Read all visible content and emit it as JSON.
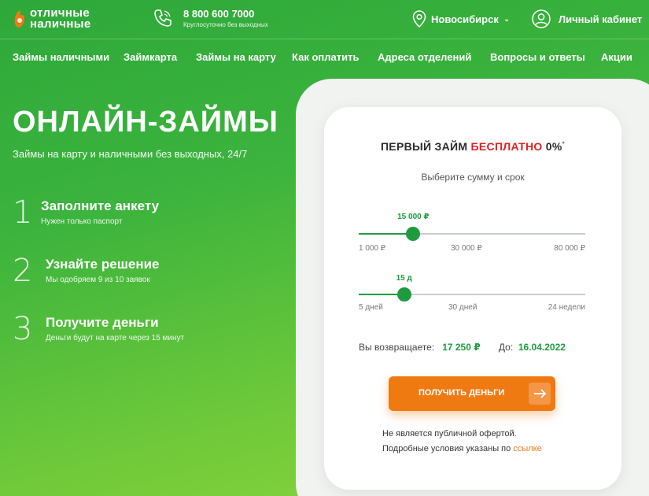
{
  "header": {
    "logo_line1": "отличные",
    "logo_line2": "наличные",
    "phone": "8 800 600 7000",
    "phone_sub": "Круглосуточно без выходных",
    "city": "Новосибирск",
    "cabinet": "Личный кабинет"
  },
  "nav": [
    {
      "label": "Займы наличными"
    },
    {
      "label": "Займкарта"
    },
    {
      "label": "Займы на карту"
    },
    {
      "label": "Как оплатить"
    },
    {
      "label": "Адреса отделений"
    },
    {
      "label": "Вопросы и ответы"
    },
    {
      "label": "Акции"
    }
  ],
  "hero": {
    "title": "ОНЛАЙН-ЗАЙМЫ",
    "subtitle": "Займы на карту и наличными без выходных, 24/7",
    "steps": [
      {
        "num": "1",
        "title": "Заполните анкету",
        "desc": "Нужен только паспорт"
      },
      {
        "num": "2",
        "title": "Узнайте решение",
        "desc": "Мы одобряем 9 из 10 заявок"
      },
      {
        "num": "3",
        "title": "Получите деньги",
        "desc": "Деньги будут на карте через 15 минут"
      }
    ]
  },
  "calculator": {
    "title_pre": "ПЕРВЫЙ ЗАЙМ ",
    "title_free": "БЕСПЛАТНО",
    "title_post": " 0%",
    "title_mark": "*",
    "subtitle": "Выберите сумму и срок",
    "amount": {
      "value_label": "15 000 ₽",
      "fraction": 0.24,
      "ticks": [
        "1 000 ₽",
        "30 000 ₽",
        "80 000 ₽"
      ]
    },
    "term": {
      "value_label": "15 д",
      "fraction": 0.2,
      "ticks": [
        "5 дней",
        "30 дней",
        "24 недели"
      ]
    },
    "return_label": "Вы возвращаете:",
    "return_value": "17 250 ₽",
    "due_label": "До:",
    "due_value": "16.04.2022",
    "button_label": "ПОЛУЧИТЬ ДЕНЬГИ",
    "disclaimer_line1": "Не является публичной офертой.",
    "disclaimer_line2": "Подробные условия указаны по ",
    "disclaimer_link": "ссылке"
  },
  "colors": {
    "brand_green": "#1e9b3e",
    "accent_orange": "#f07a12",
    "highlight_red": "#e02020"
  }
}
